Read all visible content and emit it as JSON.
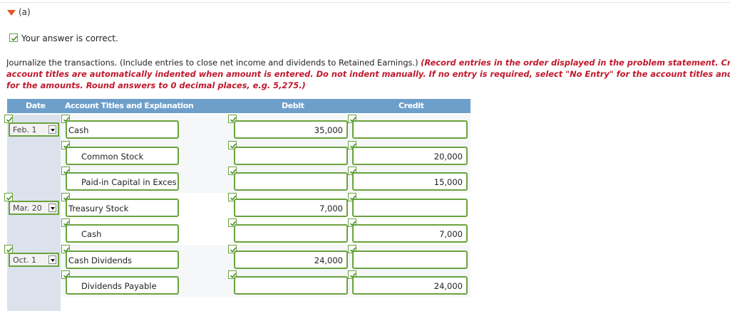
{
  "section_label": "(a)",
  "status": "Your answer is correct.",
  "instructions": {
    "plain": "Journalize the transactions. (Include entries to close net income and dividends to Retained Earnings.) ",
    "red_line1": "(Record entries in the order displayed in the problem statement. Cre",
    "red_line2": "account titles are automatically indented when amount is entered. Do not indent manually. If no entry is required, select \"No Entry\" for the account titles and er",
    "red_line3": "for the amounts. Round answers to 0 decimal places, e.g. 5,275.)"
  },
  "table": {
    "headers": {
      "date": "Date",
      "account": "Account Titles and Explanation",
      "debit": "Debit",
      "credit": "Credit"
    },
    "rows": [
      {
        "date": "Feb. 1",
        "account": "Cash",
        "debit": "35,000",
        "credit": ""
      },
      {
        "date": "",
        "account": "Common Stock",
        "debit": "",
        "credit": "20,000"
      },
      {
        "date": "",
        "account": "Paid-in Capital in Exces",
        "debit": "",
        "credit": "15,000"
      },
      {
        "date": "Mar. 20",
        "account": "Treasury Stock",
        "debit": "7,000",
        "credit": ""
      },
      {
        "date": "",
        "account": "Cash",
        "debit": "",
        "credit": "7,000"
      },
      {
        "date": "Oct. 1",
        "account": "Cash Dividends",
        "debit": "24,000",
        "credit": ""
      },
      {
        "date": "",
        "account": "Dividends Payable",
        "debit": "",
        "credit": "24,000"
      }
    ]
  },
  "colors": {
    "accent_orange": "#e2571e",
    "header_blue": "#6e9fcb",
    "check_green": "#6aa33e",
    "instruction_red": "#c0192d"
  }
}
